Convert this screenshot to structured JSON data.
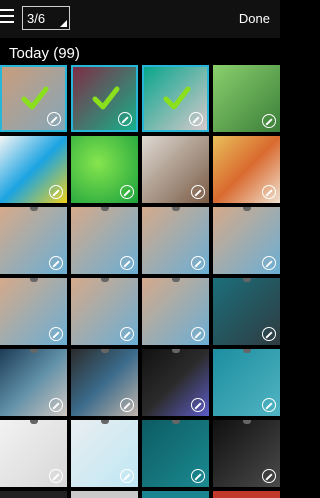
{
  "topbar": {
    "menu_icon": "hamburger-menu-icon",
    "counter": "3/6",
    "done_label": "Done"
  },
  "section": {
    "title": "Today (99)"
  },
  "colors": {
    "selection": "#27b6d8",
    "check": "#8be01d"
  },
  "tiles": [
    {
      "label": "tile-1",
      "selected": true
    },
    {
      "label": "tile-2",
      "selected": true
    },
    {
      "label": "tile-3",
      "selected": true
    },
    {
      "label": "tile-4",
      "selected": false
    }
  ]
}
